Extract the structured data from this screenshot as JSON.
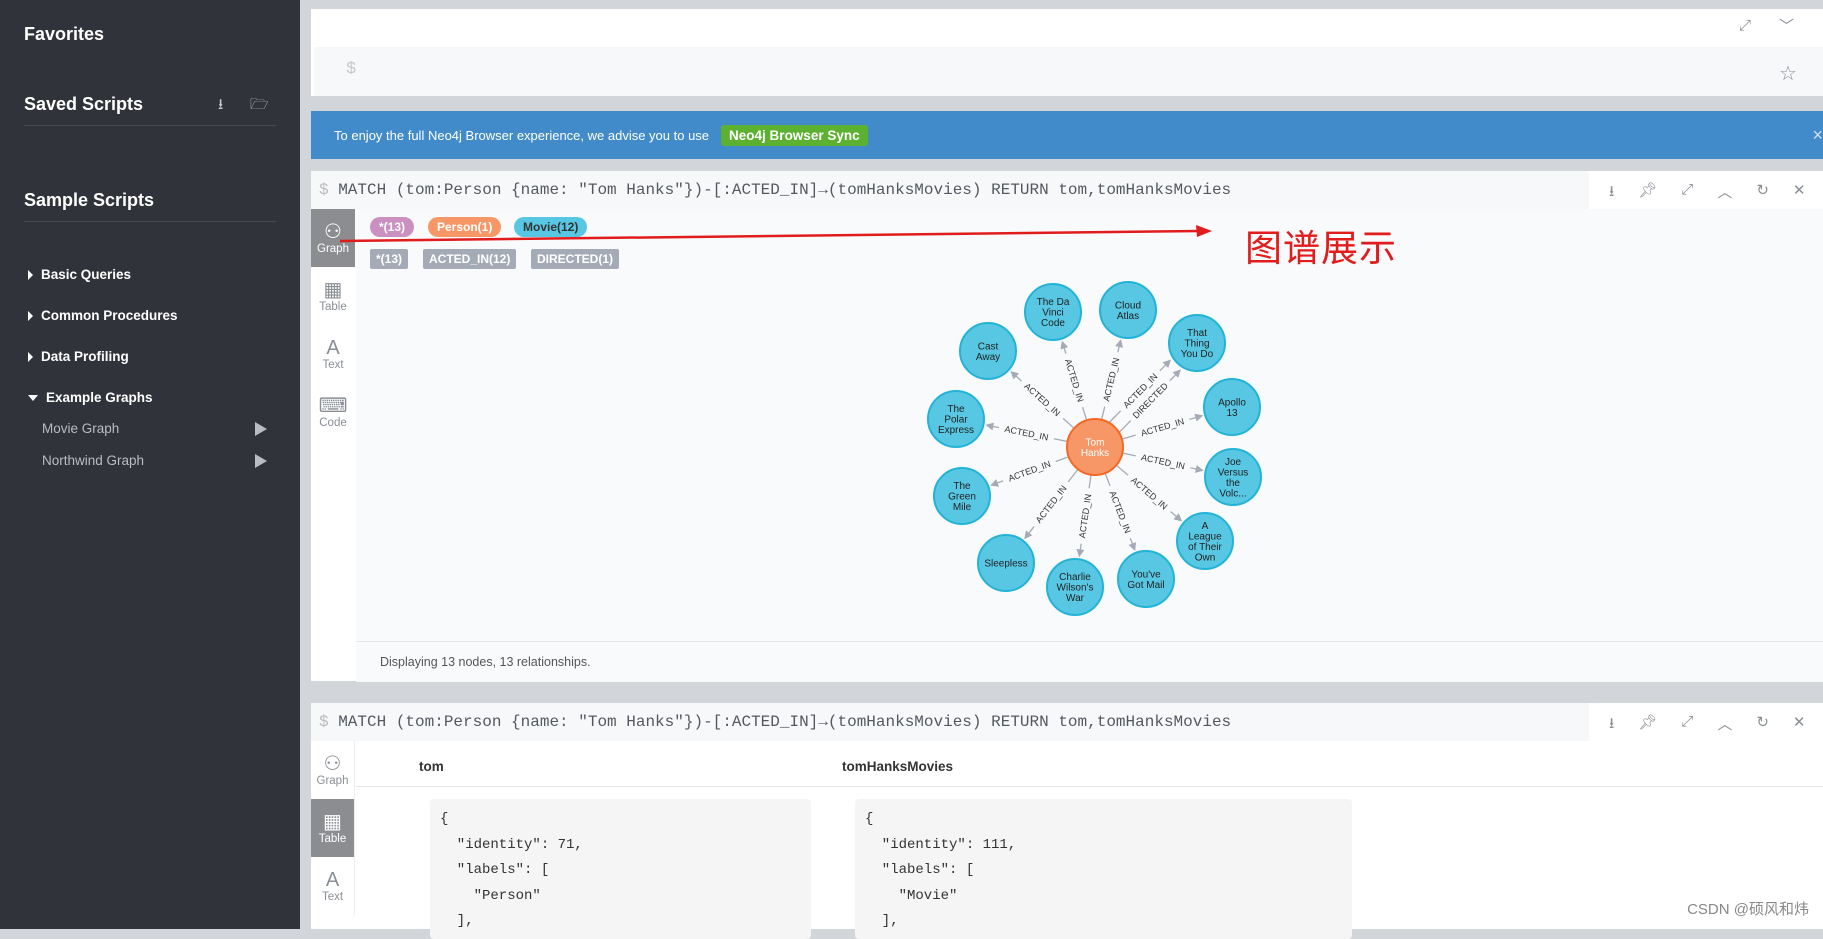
{
  "sidebar": {
    "favorites": "Favorites",
    "saved_scripts": "Saved Scripts",
    "sample_scripts": "Sample Scripts",
    "items": [
      {
        "label": "Basic Queries",
        "expanded": false
      },
      {
        "label": "Common Procedures",
        "expanded": false
      },
      {
        "label": "Data Profiling",
        "expanded": false
      },
      {
        "label": "Example Graphs",
        "expanded": true
      }
    ],
    "sub_items": [
      {
        "label": "Movie Graph"
      },
      {
        "label": "Northwind Graph"
      }
    ]
  },
  "editor": {
    "prompt": "$"
  },
  "banner": {
    "text": "To enjoy the full Neo4j Browser experience, we advise you to use",
    "button": "Neo4j Browser Sync",
    "close": "×"
  },
  "frame1": {
    "query": "MATCH (tom:Person {name: \"Tom Hanks\"})-[:ACTED_IN]→(tomHanksMovies) RETURN tom,tomHanksMovies",
    "tabs": [
      "Graph",
      "Table",
      "Text",
      "Code"
    ],
    "active_tab": "Graph",
    "node_labels": [
      {
        "label": "*(13)",
        "color": "#c990c0"
      },
      {
        "label": "Person(1)",
        "color": "#f79767"
      },
      {
        "label": "Movie(12)",
        "color": "#57c7e3"
      }
    ],
    "rel_types": [
      "*(13)",
      "ACTED_IN(12)",
      "DIRECTED(1)"
    ],
    "footer": "Displaying 13 nodes, 13 relationships.",
    "graph": {
      "center": {
        "name": "Tom\nHanks",
        "color": "#f79767",
        "border": "#f36924"
      },
      "movie_color": "#57c7e3",
      "movie_border": "#23b3d7",
      "movies": [
        "The Da\nVinci\nCode",
        "Cloud\nAtlas",
        "That\nThing\nYou Do",
        "Apollo\n13",
        "Joe\nVersus\nthe\nVolc...",
        "A\nLeague\nof Their\nOwn",
        "You've\nGot Mail",
        "Charlie\nWilson's\nWar",
        "Sleepless",
        "The\nGreen\nMile",
        "The\nPolar\nExpress",
        "Cast\nAway"
      ],
      "relationships": [
        {
          "type": "ACTED_IN",
          "to": 0
        },
        {
          "type": "ACTED_IN",
          "to": 1
        },
        {
          "type": "ACTED_IN",
          "to": 2
        },
        {
          "type": "DIRECTED",
          "to": 2
        },
        {
          "type": "ACTED_IN",
          "to": 3
        },
        {
          "type": "ACTED_IN",
          "to": 4
        },
        {
          "type": "ACTED_IN",
          "to": 5
        },
        {
          "type": "ACTED_IN",
          "to": 6
        },
        {
          "type": "ACTED_IN",
          "to": 7
        },
        {
          "type": "ACTED_IN",
          "to": 8
        },
        {
          "type": "ACTED_IN",
          "to": 9
        },
        {
          "type": "ACTED_IN",
          "to": 10
        },
        {
          "type": "ACTED_IN",
          "to": 11
        }
      ]
    }
  },
  "annotation": "图谱展示",
  "frame2": {
    "query": "MATCH (tom:Person {name: \"Tom Hanks\"})-[:ACTED_IN]→(tomHanksMovies) RETURN tom,tomHanksMovies",
    "tabs": [
      "Graph",
      "Table",
      "Text"
    ],
    "active_tab": "Table",
    "columns": [
      "tom",
      "tomHanksMovies"
    ],
    "cells": [
      "{\n  \"identity\": 71,\n  \"labels\": [\n    \"Person\"\n  ],",
      "{\n  \"identity\": 111,\n  \"labels\": [\n    \"Movie\"\n  ],"
    ]
  },
  "watermark": "CSDN @硕风和炜"
}
